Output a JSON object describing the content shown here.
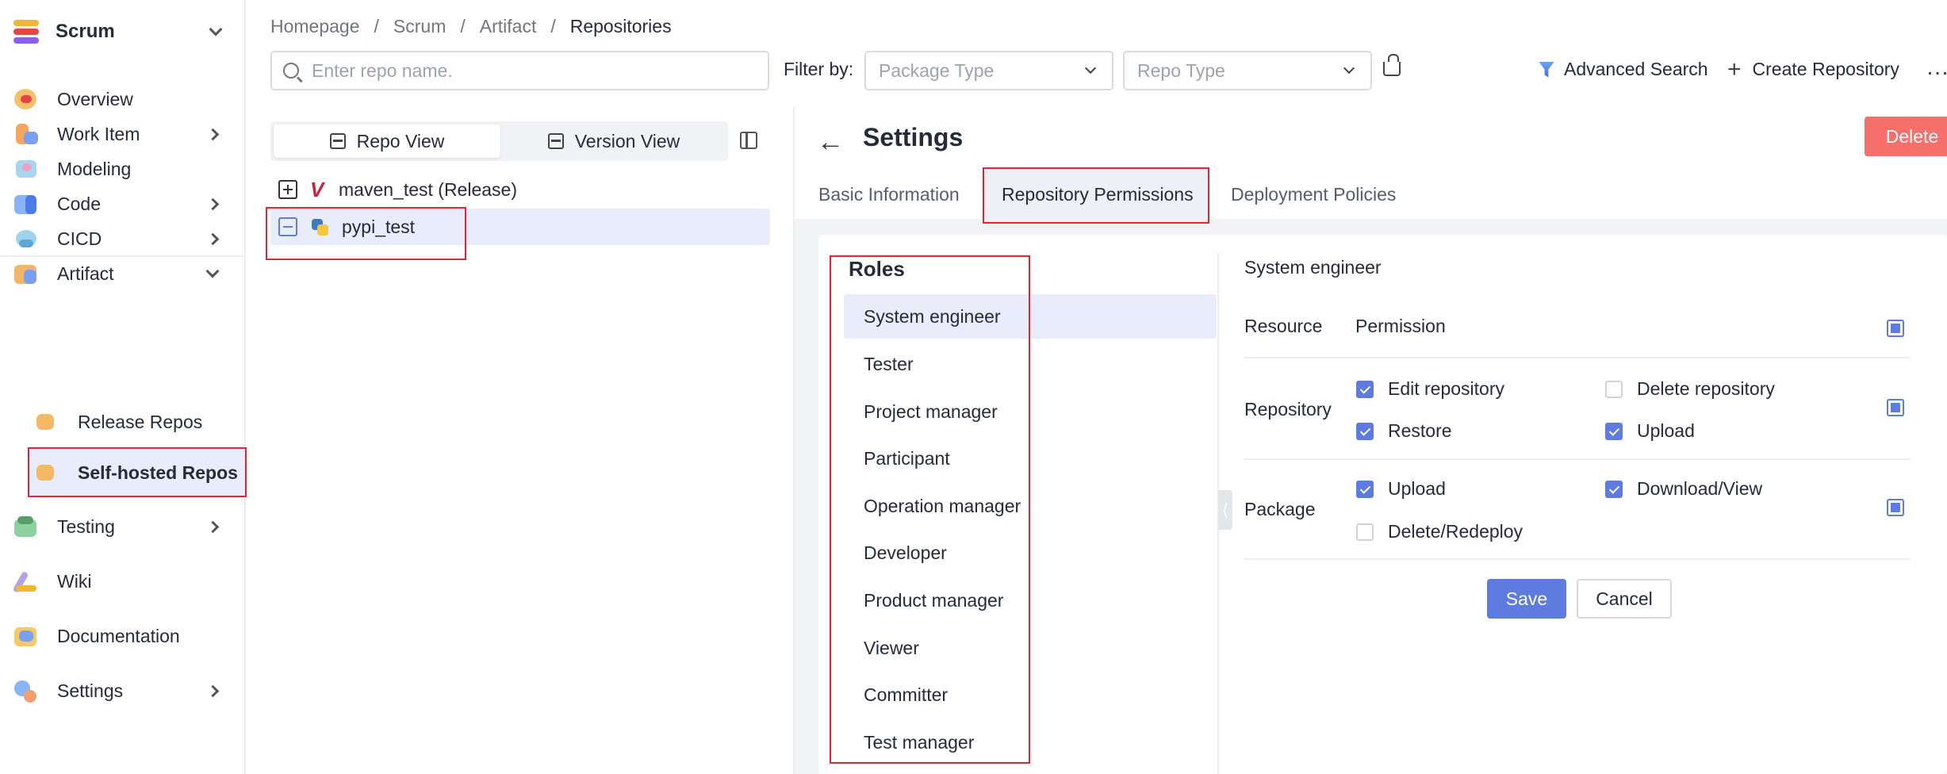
{
  "brand": {
    "name": "Scrum"
  },
  "sidebar": {
    "items": [
      {
        "label": "Overview",
        "icon": "overview-icon"
      },
      {
        "label": "Work Item",
        "icon": "work-item-icon"
      },
      {
        "label": "Modeling",
        "icon": "modeling-icon"
      },
      {
        "label": "Code",
        "icon": "code-icon"
      },
      {
        "label": "CICD",
        "icon": "cicd-icon"
      },
      {
        "label": "Artifact",
        "icon": "artifact-icon"
      },
      {
        "label": "Testing",
        "icon": "testing-icon"
      },
      {
        "label": "Wiki",
        "icon": "wiki-icon"
      },
      {
        "label": "Documentation",
        "icon": "documentation-icon"
      },
      {
        "label": "Settings",
        "icon": "settings-icon"
      }
    ],
    "artifact_sub": [
      {
        "label": "Release Repos"
      },
      {
        "label": "Self-hosted Repos"
      }
    ]
  },
  "breadcrumb": [
    "Homepage",
    "/",
    "Scrum",
    "/",
    "Artifact",
    "/",
    "Repositories"
  ],
  "search": {
    "placeholder": "Enter repo name."
  },
  "filter": {
    "label": "Filter by:",
    "package_type_placeholder": "Package Type",
    "repo_type_placeholder": "Repo Type"
  },
  "header_actions": {
    "advanced_search": "Advanced Search",
    "create_repository": "Create Repository",
    "more": "…"
  },
  "views": {
    "repo_view": "Repo View",
    "version_view": "Version View"
  },
  "repos": [
    {
      "name": "maven_test (Release)"
    },
    {
      "name": "pypi_test"
    }
  ],
  "settings": {
    "title": "Settings",
    "delete_label": "Delete",
    "tabs": [
      "Basic Information",
      "Repository Permissions",
      "Deployment Policies"
    ],
    "active_tab": "Repository Permissions"
  },
  "roles": {
    "title": "Roles",
    "items": [
      "System engineer",
      "Tester",
      "Project manager",
      "Participant",
      "Operation manager",
      "Developer",
      "Product manager",
      "Viewer",
      "Committer",
      "Test manager"
    ],
    "selected": "System engineer"
  },
  "permissions": {
    "role": "System engineer",
    "resource_header": "Resource",
    "permission_header": "Permission",
    "repository": {
      "label": "Repository",
      "items": [
        {
          "label": "Edit repository",
          "checked": true
        },
        {
          "label": "Delete repository",
          "checked": false
        },
        {
          "label": "Restore",
          "checked": true
        },
        {
          "label": "Upload",
          "checked": true
        }
      ]
    },
    "package": {
      "label": "Package",
      "items": [
        {
          "label": "Upload",
          "checked": true
        },
        {
          "label": "Download/View",
          "checked": true
        },
        {
          "label": "Delete/Redeploy",
          "checked": false
        }
      ]
    },
    "save_label": "Save",
    "cancel_label": "Cancel"
  },
  "colors": {
    "accent": "#5e7ce0",
    "danger": "#f66f6a",
    "highlight": "#e4262e",
    "selected_bg": "#e9ecfa"
  }
}
